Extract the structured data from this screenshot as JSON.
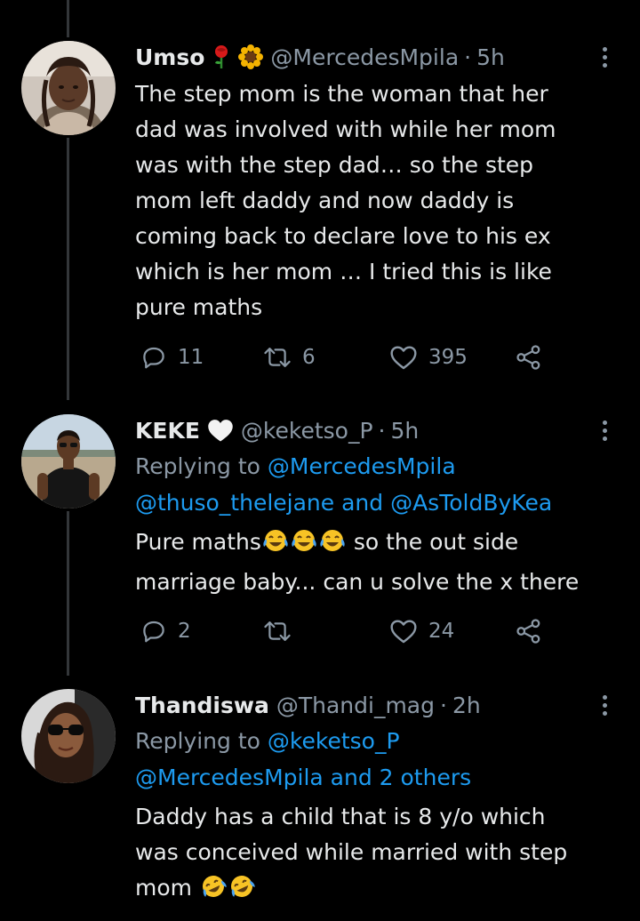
{
  "tweets": [
    {
      "display_name": "Umso",
      "badge_icons": [
        "rose-emoji",
        "sunflower-emoji"
      ],
      "handle": "@MercedesMpila",
      "separator": "·",
      "time": "5h",
      "body_lines": [
        "The step mom is the woman that her",
        "dad was involved with while her mom",
        "was with the step dad… so the step",
        "mom left daddy and now daddy is",
        "coming back to declare love to his ex",
        "which is her mom … I tried this is like",
        "pure maths"
      ],
      "replies": "11",
      "retweets": "6",
      "likes": "395"
    },
    {
      "display_name": "KEKE",
      "badge_icons": [
        "white-heart-emoji"
      ],
      "handle": "@keketso_P",
      "separator": "·",
      "time": "5h",
      "reply_prefix": "Replying to",
      "reply_line1_link": "@MercedesMpila",
      "reply_line2": "@thuso_thelejane and @AsToldByKea",
      "body_line1_a": "Pure maths",
      "body_line1_b": " so the out side",
      "body_line2": "marriage baby... can u solve the x there",
      "replies": "2",
      "retweets": "",
      "likes": "24"
    },
    {
      "display_name": "Thandiswa",
      "handle": "@Thandi_mag",
      "separator": "·",
      "time": "2h",
      "reply_prefix": "Replying to",
      "reply_line1_link": "@keketso_P",
      "reply_line2": "@MercedesMpila and 2 others",
      "body_line1": "Daddy has a child that is 8 y/o which",
      "body_line2": "was conceived while married with step",
      "body_line3": "mom"
    }
  ],
  "colors": {
    "background": "#000000",
    "text": "#e7e9ea",
    "muted": "#8b98a5",
    "link": "#1d9bf0",
    "thread_line": "#333639"
  }
}
